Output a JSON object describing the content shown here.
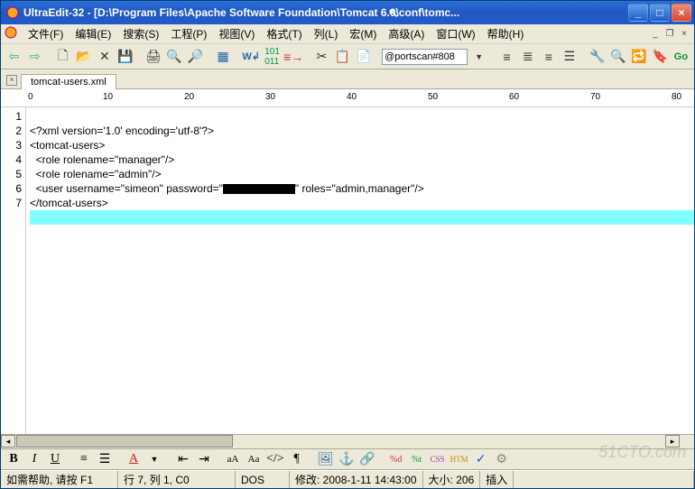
{
  "title": "UltraEdit-32 - [D:\\Program Files\\Apache Software Foundation\\Tomcat 6.0\\conf\\tomc...",
  "menu": [
    "文件(F)",
    "编辑(E)",
    "搜索(S)",
    "工程(P)",
    "视图(V)",
    "格式(T)",
    "列(L)",
    "宏(M)",
    "高级(A)",
    "窗口(W)",
    "帮助(H)"
  ],
  "toolbar_field": "@portscan#808",
  "tab_label": "tomcat-users.xml",
  "ruler_marks": [
    "0",
    "10",
    "20",
    "30",
    "40",
    "50",
    "60",
    "70",
    "80"
  ],
  "code": {
    "lines": [
      "<?xml version='1.0' encoding='utf-8'?>",
      "<tomcat-users>",
      "  <role rolename=\"manager\"/>",
      "  <role rolename=\"admin\"/>",
      "  <user username=\"simeon\" password=\"",
      "</tomcat-users>",
      ""
    ],
    "line5_tail": "\" roles=\"admin,manager\"/>",
    "count": 7,
    "highlight": 7
  },
  "status": {
    "help": "如需帮助, 请按 F1",
    "pos": "行 7, 列 1, C0",
    "enc": "DOS",
    "mod": "修改: 2008-1-11 14:43:00",
    "size": "大小: 206",
    "ins": "插入"
  },
  "watermark": "51CTO.com"
}
